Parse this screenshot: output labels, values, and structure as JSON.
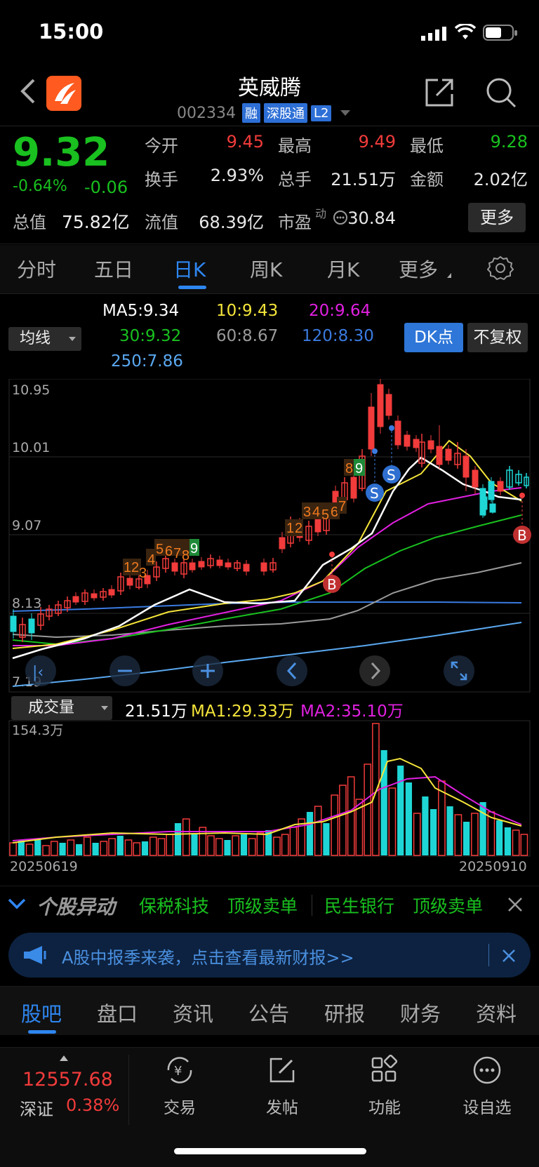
{
  "status_bar": {
    "time": "15:00"
  },
  "header": {
    "title": "英威腾",
    "code": "002334",
    "tags": [
      "融",
      "深股通",
      "L2"
    ]
  },
  "quote": {
    "price": "9.32",
    "change_pct": "-0.64%",
    "change": "-0.06",
    "total_value_label": "总值",
    "total_value": "75.82亿",
    "fields": [
      {
        "label": "今开",
        "value": "9.45"
      },
      {
        "label": "最高",
        "value": "9.49"
      },
      {
        "label": "最低",
        "value": "9.28"
      },
      {
        "label": "换手",
        "value": "2.93%"
      },
      {
        "label": "总手",
        "value": "21.51万"
      },
      {
        "label": "金额",
        "value": "2.02亿"
      },
      {
        "label": "流值",
        "value": "68.39亿"
      },
      {
        "label": "市盈",
        "value": "30.84"
      }
    ],
    "pe_superscript": "动",
    "more_button": "更多"
  },
  "period_tabs": [
    "分时",
    "五日",
    "日K",
    "周K",
    "月K",
    "更多"
  ],
  "ma_legend": {
    "selector": "均线",
    "ma5": "MA5:9.34",
    "ma10": "10:9.43",
    "ma20": "20:9.64",
    "ma30": "30:9.32",
    "ma60": "60:8.67",
    "ma120": "120:8.30",
    "ma250": "250:7.86",
    "dk_button": "DK点",
    "fq_button": "不复权"
  },
  "kline": {
    "y_labels": [
      "10.95",
      "10.01",
      "9.07",
      "8.13",
      "7.19"
    ],
    "signals": [
      "S",
      "S",
      "B",
      "B"
    ],
    "counts_orange": [
      "1",
      "2",
      "3",
      "4",
      "5",
      "6",
      "7",
      "8",
      "1",
      "2",
      "3",
      "4",
      "5",
      "6",
      "7",
      "8"
    ],
    "counts_green": [
      "9",
      "9"
    ]
  },
  "volume": {
    "selector": "成交量",
    "current": "21.51万",
    "ma1": "MA1:29.33万",
    "ma2": "MA2:35.10万",
    "max_label": "154.3万",
    "start_date": "20250619",
    "end_date": "20250910"
  },
  "ticker": {
    "title": "个股异动",
    "items": [
      "保税科技",
      "顶级卖单",
      "民生银行",
      "顶级卖单"
    ]
  },
  "banner": {
    "text": "A股中报季来袭，点击查看最新财报>>"
  },
  "sub_tabs": [
    "股吧",
    "盘口",
    "资讯",
    "公告",
    "研报",
    "财务",
    "资料"
  ],
  "bottom": {
    "index_value": "12557.68",
    "index_name": "深证",
    "index_pct": "0.38%",
    "nav": [
      "交易",
      "发帖",
      "功能",
      "设自选"
    ]
  },
  "colors": {
    "up": "#f23b3b",
    "down": "#19c01f",
    "accent": "#2e86f0",
    "ma5": "#ffffff",
    "ma10": "#f5e53a",
    "ma20": "#e020e0",
    "ma30": "#19c01f",
    "ma60": "#9a9a9a",
    "ma120": "#3a7be0",
    "ma250": "#5aa8f0"
  }
}
